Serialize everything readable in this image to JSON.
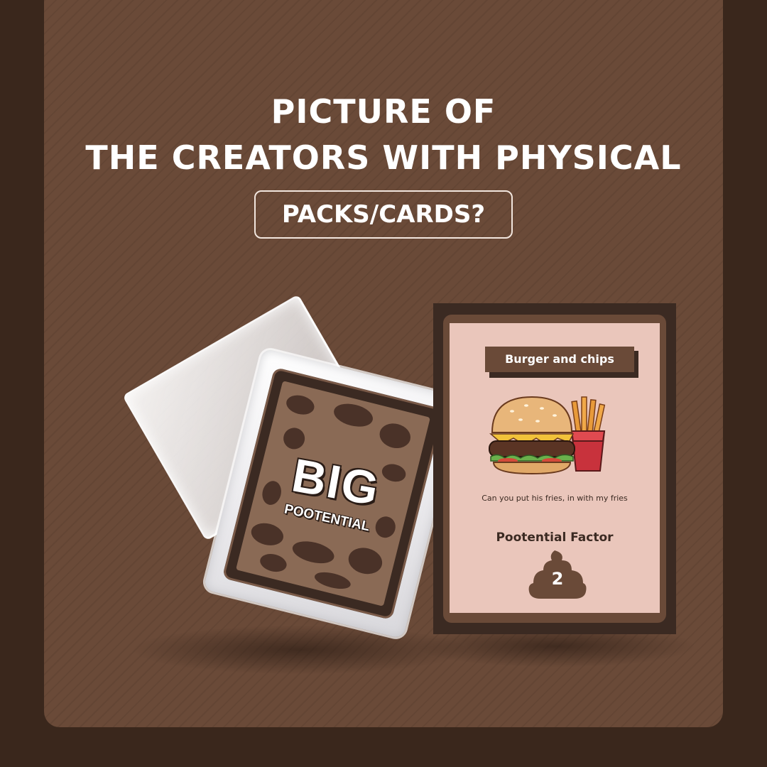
{
  "heading": {
    "line1": "PICTURE OF",
    "line2": "THE CREATORS WITH PHYSICAL",
    "subtitle": "PACKS/CARDS?"
  },
  "pack": {
    "brand_big": "BIG",
    "brand_small": "POOTENTIAL"
  },
  "card": {
    "title": "Burger and chips",
    "image_icon": "burger-and-fries-icon",
    "caption": "Can you put his fries, in with my fries",
    "factor_label": "Pootential Factor",
    "factor_value": "2",
    "factor_icon": "poop-icon"
  },
  "colors": {
    "background": "#3a271c",
    "panel": "#6a4a38",
    "card_face": "#eac6bb",
    "dark_brown": "#3b2a22"
  }
}
